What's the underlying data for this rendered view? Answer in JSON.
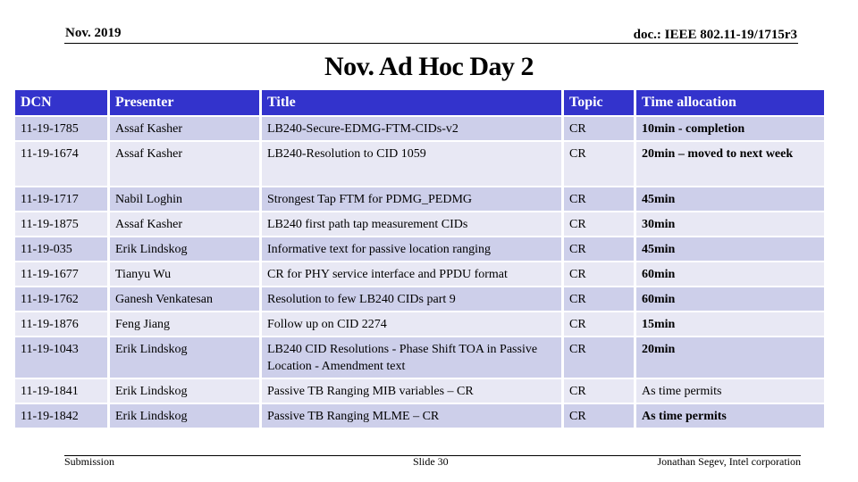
{
  "header": {
    "date": "Nov. 2019",
    "doc": "doc.: IEEE 802.11-19/1715r3"
  },
  "title": "Nov. Ad Hoc Day 2",
  "table": {
    "columns": [
      "DCN",
      "Presenter",
      "Title",
      "Topic",
      "Time allocation"
    ],
    "rows": [
      {
        "dcn": "11-19-1785",
        "presenter": "Assaf Kasher",
        "title": "LB240-Secure-EDMG-FTM-CIDs-v2",
        "topic": "CR",
        "time": "10min - completion"
      },
      {
        "dcn": "11-19-1674",
        "presenter": "Assaf Kasher",
        "title": "LB240-Resolution to CID 1059",
        "topic": "CR",
        "time": "20min – moved to next week"
      },
      {
        "dcn": "11-19-1717",
        "presenter": "Nabil Loghin",
        "title": "Strongest Tap FTM for PDMG_PEDMG",
        "topic": "CR",
        "time": "45min"
      },
      {
        "dcn": "11-19-1875",
        "presenter": "Assaf Kasher",
        "title": "LB240 first path tap measurement CIDs",
        "topic": "CR",
        "time": "30min"
      },
      {
        "dcn": "11-19-035",
        "presenter": "Erik Lindskog",
        "title": "Informative text for passive location ranging",
        "topic": "CR",
        "time": "45min"
      },
      {
        "dcn": "11-19-1677",
        "presenter": "Tianyu Wu",
        "title": "CR for PHY service interface and PPDU format",
        "topic": "CR",
        "time": "60min"
      },
      {
        "dcn": "11-19-1762",
        "presenter": "Ganesh Venkatesan",
        "title": "Resolution to few LB240 CIDs part 9",
        "topic": "CR",
        "time": "60min"
      },
      {
        "dcn": "11-19-1876",
        "presenter": "Feng Jiang",
        "title": "Follow up on CID 2274",
        "topic": "CR",
        "time": "15min"
      },
      {
        "dcn": "11-19-1043",
        "presenter": "Erik Lindskog",
        "title": "LB240 CID Resolutions - Phase Shift TOA in Passive Location - Amendment text",
        "topic": "CR",
        "time": "20min"
      },
      {
        "dcn": "11-19-1841",
        "presenter": "Erik Lindskog",
        "title": "Passive TB Ranging MIB variables – CR",
        "topic": "CR",
        "time": "As time permits"
      },
      {
        "dcn": "11-19-1842",
        "presenter": "Erik Lindskog",
        "title": "Passive TB Ranging MLME – CR",
        "topic": "CR",
        "time": "As time permits"
      }
    ]
  },
  "footer": {
    "left": "Submission",
    "center": "Slide 30",
    "right": "Jonathan Segev, Intel corporation"
  },
  "colors": {
    "header_bg": "#3333cc",
    "row_odd_bg": "#cdcfea",
    "row_even_bg": "#e8e8f4"
  }
}
